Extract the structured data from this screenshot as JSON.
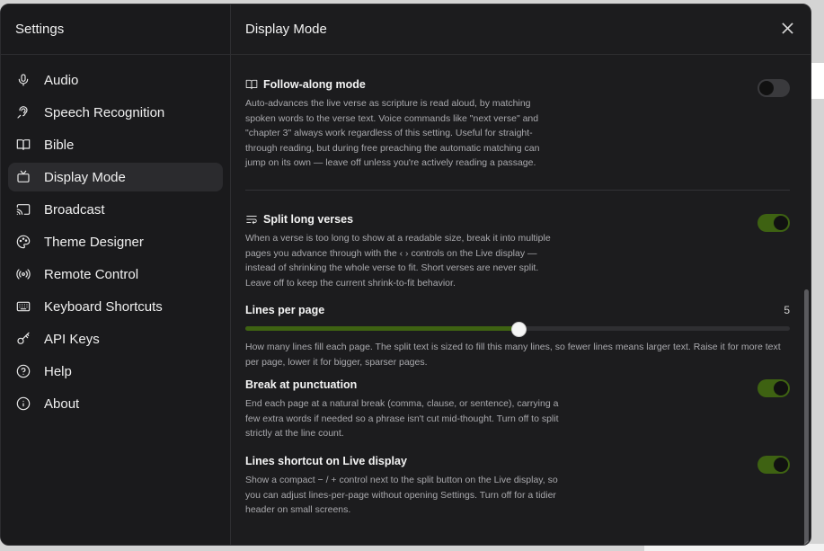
{
  "sidebar": {
    "title": "Settings",
    "items": [
      {
        "label": "Audio",
        "icon": "microphone-icon",
        "active": false
      },
      {
        "label": "Speech Recognition",
        "icon": "ear-icon",
        "active": false
      },
      {
        "label": "Bible",
        "icon": "open-book-icon",
        "active": false
      },
      {
        "label": "Display Mode",
        "icon": "tv-icon",
        "active": true
      },
      {
        "label": "Broadcast",
        "icon": "cast-icon",
        "active": false
      },
      {
        "label": "Theme Designer",
        "icon": "palette-icon",
        "active": false
      },
      {
        "label": "Remote Control",
        "icon": "radio-waves-icon",
        "active": false
      },
      {
        "label": "Keyboard Shortcuts",
        "icon": "keyboard-icon",
        "active": false
      },
      {
        "label": "API Keys",
        "icon": "key-icon",
        "active": false
      },
      {
        "label": "Help",
        "icon": "help-circle-icon",
        "active": false
      },
      {
        "label": "About",
        "icon": "info-icon",
        "active": false
      }
    ]
  },
  "main": {
    "title": "Display Mode",
    "close_icon": "close-icon",
    "follow_along": {
      "title": "Follow-along mode",
      "icon": "book-icon",
      "description": "Auto-advances the live verse as scripture is read aloud, by matching spoken words to the verse text. Voice commands like \"next verse\" and \"chapter 3\" always work regardless of this setting. Useful for straight-through reading, but during free preaching the automatic matching can jump on its own — leave off unless you're actively reading a passage.",
      "enabled": false
    },
    "split_verses": {
      "title": "Split long verses",
      "icon": "wrap-text-icon",
      "description": "When a verse is too long to show at a readable size, break it into multiple pages you advance through with the ‹ › controls on the Live display — instead of shrinking the whole verse to fit. Short verses are never split. Leave off to keep the current shrink-to-fit behavior.",
      "enabled": true
    },
    "lines_per_page": {
      "label": "Lines per page",
      "value": "5",
      "fraction": 0.5,
      "description": "How many lines fill each page. The split text is sized to fill this many lines, so fewer lines means larger text. Raise it for more text per page, lower it for bigger, sparser pages."
    },
    "break_punctuation": {
      "title": "Break at punctuation",
      "description": "End each page at a natural break (comma, clause, or sentence), carrying a few extra words if needed so a phrase isn't cut mid-thought. Turn off to split strictly at the line count.",
      "enabled": true
    },
    "lines_shortcut": {
      "title": "Lines shortcut on Live display",
      "description": "Show a compact − / + control next to the split button on the Live display, so you can adjust lines-per-page without opening Settings. Turn off for a tidier header on small screens.",
      "enabled": true
    }
  },
  "colors": {
    "accent": "#3e6212",
    "background": "#1c1c1e",
    "sidebar_active": "#2b2b2e"
  }
}
